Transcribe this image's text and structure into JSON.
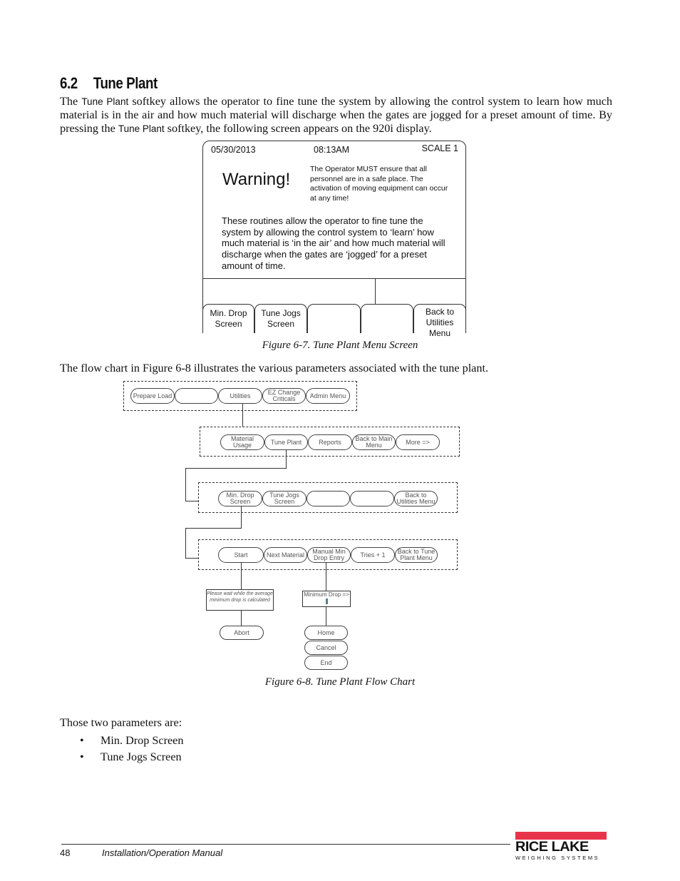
{
  "section": {
    "number": "6.2",
    "title": "Tune Plant"
  },
  "intro": {
    "p1": "The ",
    "k1": "Tune Plant",
    "p2": " softkey allows the operator to fine tune the system by allowing the control system to learn how much material is in the air and how much material will discharge when the gates are jogged for a preset amount of time. By pressing the ",
    "k2": "Tune Plant",
    "p3": " softkey, the following screen appears on the 920i display."
  },
  "screen": {
    "date": "05/30/2013",
    "time": "08:13AM",
    "scale": "SCALE 1",
    "warning": "Warning!",
    "warning_text": "The Operator MUST ensure that all personnel are in a safe place. The activation of moving equipment can occur at any time!",
    "body": "These routines allow the operator to fine tune the system by allowing the control system to ‘learn’ how much material is ‘in the air’ and how much material will discharge when the gates are ‘jogged’ for a preset amount of time.",
    "softkeys": [
      "Min. Drop Screen",
      "Tune Jogs Screen",
      "",
      "",
      "Back to Utilities Menu"
    ]
  },
  "figure7_caption": "Figure 6-7. Tune Plant Menu Screen",
  "flow_intro": "The flow chart in Figure 6-8 illustrates the various parameters associated with the tune plant.",
  "flow": {
    "row1": [
      "Prepare Load",
      "",
      "Utilities",
      "EZ Change Criticals",
      "Admin Menu"
    ],
    "row2": [
      "Material Usage",
      "Tune Plant",
      "Reports",
      "Back to Main Menu",
      "More =>"
    ],
    "row3": [
      "Min. Drop Screen",
      "Tune Jogs Screen",
      "",
      "",
      "Back to Utilities Menu"
    ],
    "row4": [
      "Start",
      "Next Material",
      "Manual Min Drop Entry",
      "Tries + 1",
      "Back to Tune Plant Menu"
    ],
    "wait_box": "Please wait while the average minimum drop is calculated",
    "abort": "Abort",
    "min_drop_box": "Minimum Drop =>",
    "entry_keys": [
      "Home",
      "Cancel",
      "End"
    ]
  },
  "figure8_caption": "Figure 6-8. Tune Plant Flow Chart",
  "params_intro": "Those two parameters are:",
  "params": [
    "Min. Drop Screen",
    "Tune Jogs Screen"
  ],
  "footer": {
    "page": "48",
    "doc": "Installation/Operation Manual",
    "logo_main": "RICE LAKE",
    "logo_sub": "WEIGHING SYSTEMS",
    "logo_color": "#e8344a"
  }
}
